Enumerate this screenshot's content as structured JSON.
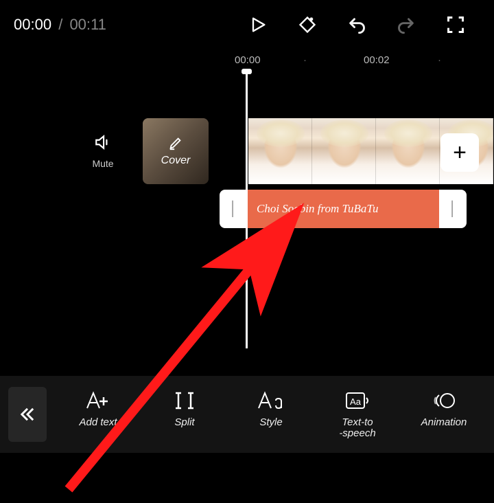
{
  "playback": {
    "current": "00:00",
    "total": "00:11"
  },
  "ruler": {
    "t0": "00:00",
    "t1": "00:02"
  },
  "tracks": {
    "mute_label": "Mute",
    "cover_label": "Cover",
    "text_clip": "Choi Soobin from TuBaTu"
  },
  "toolbar": {
    "add_text": "Add text",
    "split": "Split",
    "style": "Style",
    "tts": "Text-to\n-speech",
    "animation": "Animation"
  },
  "icons": {
    "play": "play-icon",
    "keyframe": "keyframe-add-icon",
    "undo": "undo-icon",
    "redo": "redo-icon",
    "fullscreen": "fullscreen-icon",
    "speaker": "speaker-icon",
    "pencil": "pencil-icon",
    "plus": "+",
    "chevrons": "chevrons-left-icon"
  },
  "colors": {
    "accent": "#e96a4a",
    "annotation": "#ff1a1a"
  }
}
